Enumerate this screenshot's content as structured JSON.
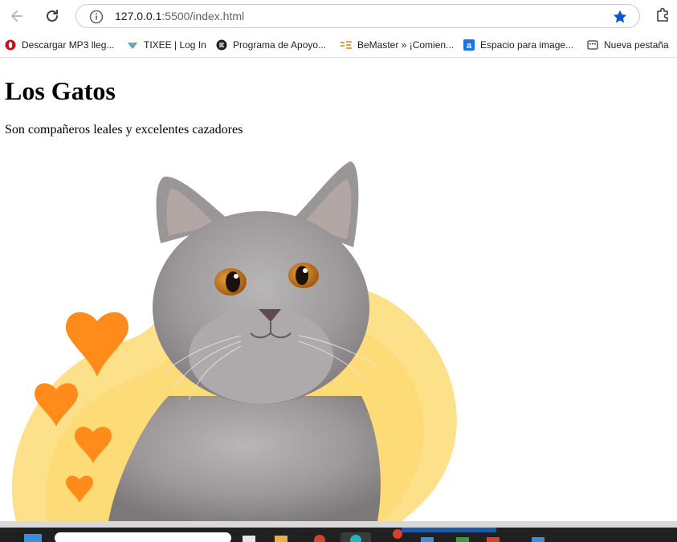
{
  "browser": {
    "url_host": "127.0.0.1",
    "url_rest": ":5500/index.html"
  },
  "bookmarks": [
    {
      "label": "Descargar MP3 lleg...",
      "icon": "opera-icon"
    },
    {
      "label": "TIXEE | Log In",
      "icon": "tixee-icon"
    },
    {
      "label": "Programa de Apoyo...",
      "icon": "e-logo-icon"
    },
    {
      "label": "BeMaster » ¡Comien...",
      "icon": "bemaster-icon"
    },
    {
      "label": "Espacio para image...",
      "icon": "a-logo-icon"
    },
    {
      "label": "Nueva pestaña",
      "icon": "new-tab-icon"
    }
  ],
  "page": {
    "title": "Los Gatos",
    "subtitle": "Son compañeros leales y excelentes cazadores"
  },
  "colors": {
    "accent_star": "#0b57d0",
    "heart": "#ff8c1a",
    "blob": "#fde08a"
  }
}
